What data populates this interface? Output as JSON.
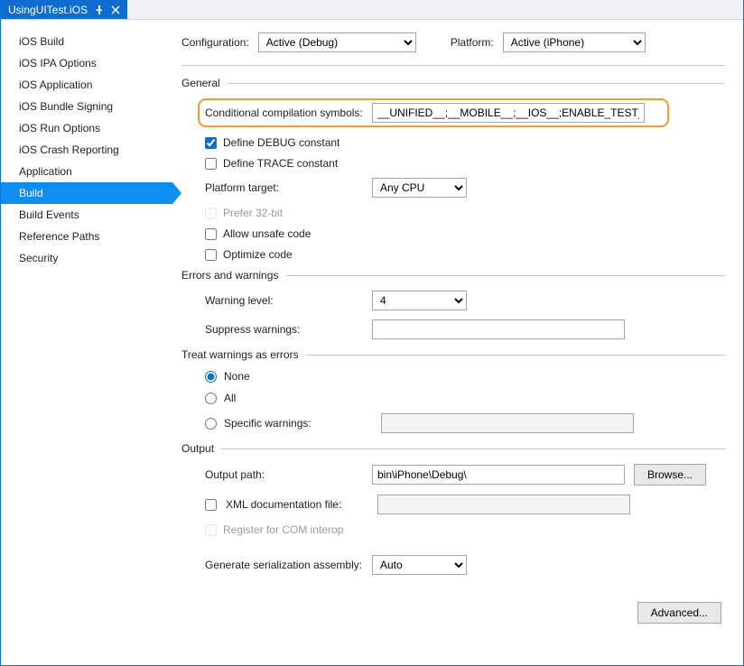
{
  "tab": {
    "title": "UsingUITest.iOS"
  },
  "sidebar": {
    "items": [
      {
        "label": "iOS Build"
      },
      {
        "label": "iOS IPA Options"
      },
      {
        "label": "iOS Application"
      },
      {
        "label": "iOS Bundle Signing"
      },
      {
        "label": "iOS Run Options"
      },
      {
        "label": "iOS Crash Reporting"
      },
      {
        "label": "Application"
      },
      {
        "label": "Build",
        "active": true
      },
      {
        "label": "Build Events"
      },
      {
        "label": "Reference Paths"
      },
      {
        "label": "Security"
      }
    ]
  },
  "top": {
    "config_label": "Configuration:",
    "config_value": "Active (Debug)",
    "platform_label": "Platform:",
    "platform_value": "Active (iPhone)"
  },
  "general": {
    "heading": "General",
    "cond_label": "Conditional compilation symbols:",
    "cond_value": "__UNIFIED__;__MOBILE__;__IOS__;ENABLE_TEST_CLOUD;",
    "define_debug": "Define DEBUG constant",
    "define_trace": "Define TRACE constant",
    "platform_target_label": "Platform target:",
    "platform_target_value": "Any CPU",
    "prefer32": "Prefer 32-bit",
    "allow_unsafe": "Allow unsafe code",
    "optimize": "Optimize code"
  },
  "errors": {
    "heading": "Errors and warnings",
    "warning_level_label": "Warning level:",
    "warning_level_value": "4",
    "suppress_label": "Suppress warnings:",
    "suppress_value": ""
  },
  "treat": {
    "heading": "Treat warnings as errors",
    "none": "None",
    "all": "All",
    "specific": "Specific warnings:",
    "specific_value": ""
  },
  "output": {
    "heading": "Output",
    "outpath_label": "Output path:",
    "outpath_value": "bin\\iPhone\\Debug\\",
    "browse": "Browse...",
    "xml_doc": "XML documentation file:",
    "xml_doc_value": "",
    "register_com": "Register for COM interop",
    "gen_ser_label": "Generate serialization assembly:",
    "gen_ser_value": "Auto"
  },
  "advanced": "Advanced..."
}
